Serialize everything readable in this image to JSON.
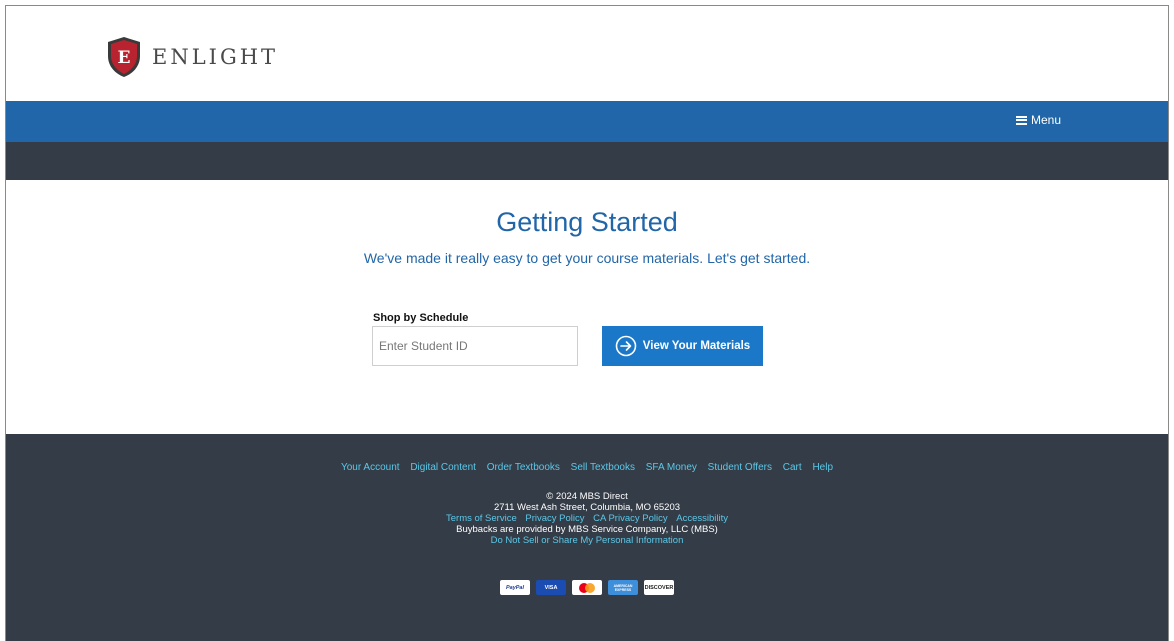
{
  "header": {
    "logo_letter": "E",
    "logo_text": "ENLIGHT"
  },
  "navbar": {
    "menu_label": "Menu"
  },
  "main": {
    "title": "Getting Started",
    "subtitle": "We've made it really easy to get your course materials. Let's get started.",
    "shop_label": "Shop by Schedule",
    "student_id_placeholder": "Enter Student ID",
    "student_id_value": "",
    "view_button_label": "View Your Materials"
  },
  "footer": {
    "links": [
      "Your Account",
      "Digital Content",
      "Order Textbooks",
      "Sell Textbooks",
      "SFA Money",
      "Student Offers",
      "Cart",
      "Help"
    ],
    "copyright": "© 2024 MBS Direct",
    "address": "2711 West Ash Street, Columbia, MO 65203",
    "legal_links": [
      "Terms of Service",
      "Privacy Policy",
      "CA Privacy Policy",
      "Accessibility"
    ],
    "buybacks": "Buybacks are provided by MBS Service Company, LLC (MBS)",
    "do_not_sell": "Do Not Sell or Share My Personal Information",
    "payment_cards": [
      {
        "name": "paypal-card-icon",
        "label": "PayPal"
      },
      {
        "name": "visa-card-icon",
        "label": "VISA"
      },
      {
        "name": "mastercard-card-icon",
        "label": ""
      },
      {
        "name": "amex-card-icon",
        "label": "AMERICAN EXPRESS"
      },
      {
        "name": "discover-card-icon",
        "label": "DISCOVER"
      }
    ]
  },
  "colors": {
    "brand_blue": "#2166a8",
    "button_blue": "#1b78c9",
    "dark_bar": "#343c47",
    "footer_link": "#5bc8e8",
    "shield_red": "#b8232f"
  }
}
